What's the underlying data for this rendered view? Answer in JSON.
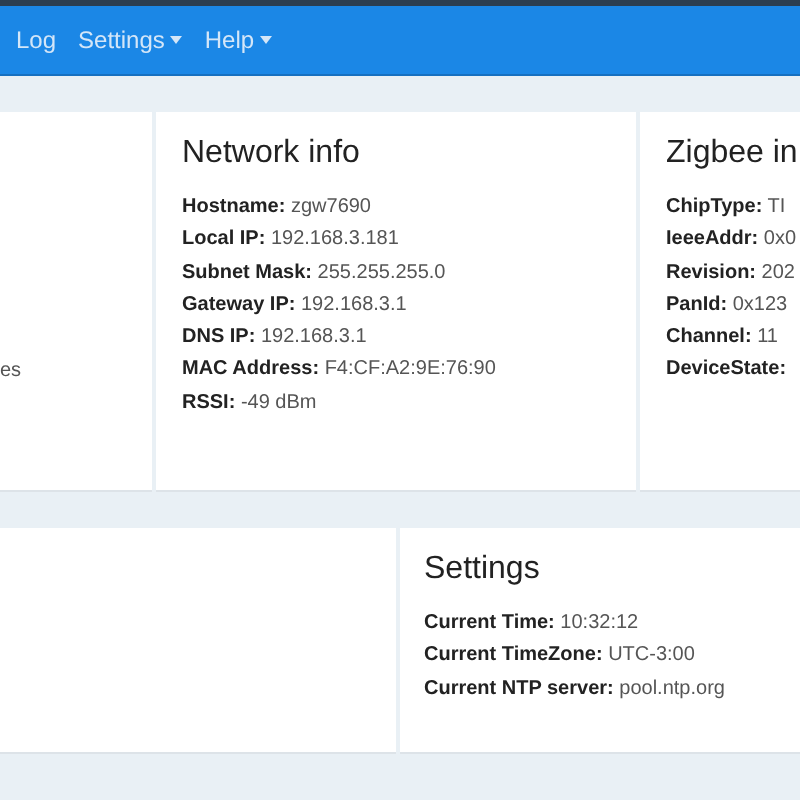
{
  "navbar": {
    "items": [
      {
        "label": "Log",
        "dropdown": false
      },
      {
        "label": "Settings",
        "dropdown": true
      },
      {
        "label": "Help",
        "dropdown": true
      }
    ]
  },
  "cards_row_1": [
    {
      "lines": [
        {
          "value": "es"
        }
      ]
    },
    {
      "title": "Network info",
      "lines": [
        {
          "label": "Hostname:",
          "value": "zgw7690"
        },
        {
          "label": "Local IP:",
          "value": "192.168.3.181"
        },
        {
          "label": "Subnet Mask:",
          "value": "255.255.255.0"
        },
        {
          "label": "Gateway IP:",
          "value": "192.168.3.1"
        },
        {
          "label": "DNS IP:",
          "value": "192.168.3.1"
        },
        {
          "label": "MAC Address:",
          "value": "F4:CF:A2:9E:76:90"
        },
        {
          "label": "RSSI:",
          "value": "-49 dBm"
        }
      ]
    },
    {
      "title": "Zigbee in",
      "lines": [
        {
          "label": "ChipType:",
          "value": "TI"
        },
        {
          "label": "IeeeAddr:",
          "value": "0x0"
        },
        {
          "label": "Revision:",
          "value": "202"
        },
        {
          "label": "PanId:",
          "value": "0x123"
        },
        {
          "label": "Channel:",
          "value": "11"
        },
        {
          "label": "DeviceState:"
        }
      ]
    }
  ],
  "cards_row_2": [
    {
      "title": "Settings",
      "lines": [
        {
          "label": "Current Time:",
          "value": "10:32:12"
        },
        {
          "label": "Current TimeZone:",
          "value": "UTC-3:00"
        },
        {
          "label": "Current NTP server:",
          "value": "pool.ntp.org"
        }
      ]
    }
  ]
}
